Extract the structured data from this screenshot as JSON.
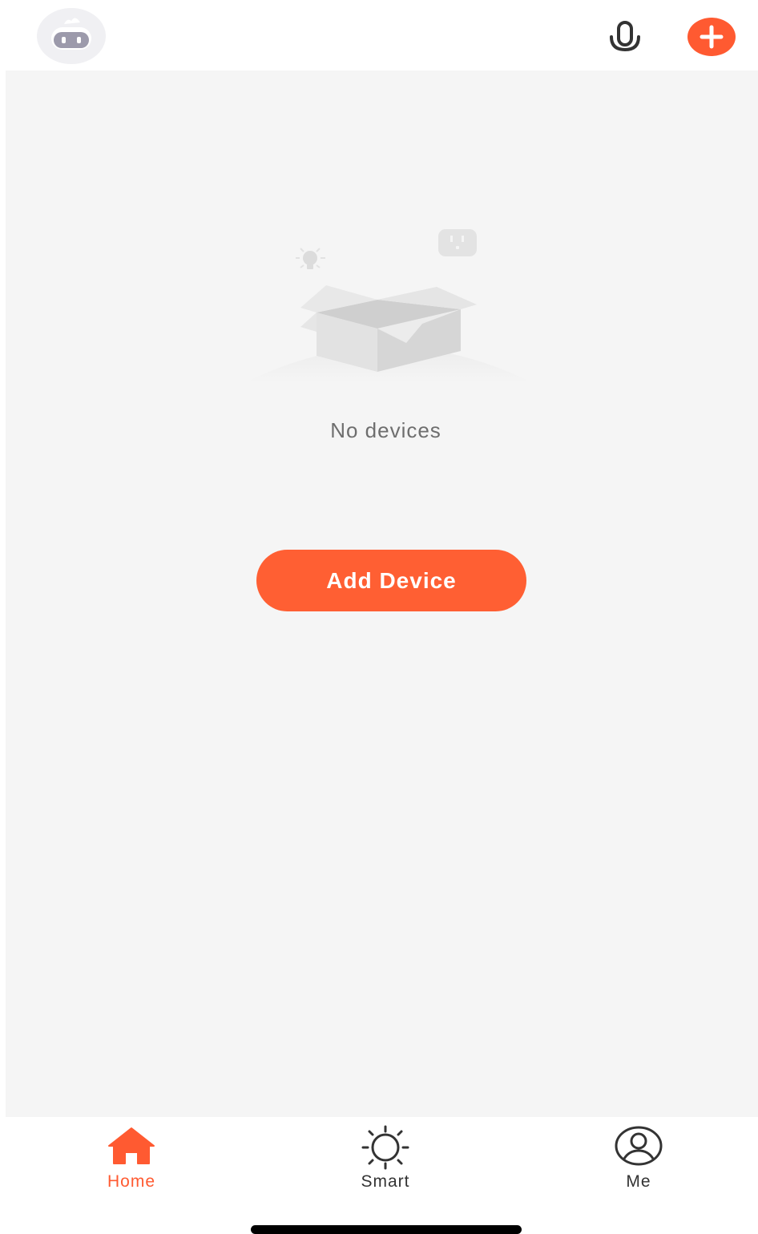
{
  "header": {
    "avatar_icon": "robot-avatar-icon",
    "mic_icon": "microphone-icon",
    "add_icon": "plus-icon"
  },
  "main": {
    "empty_illustration": "empty-box-illustration",
    "empty_text": "No devices",
    "add_device_label": "Add Device"
  },
  "tabbar": {
    "tabs": [
      {
        "label": "Home",
        "icon": "home-icon",
        "active": true
      },
      {
        "label": "Smart",
        "icon": "sun-icon",
        "active": false
      },
      {
        "label": "Me",
        "icon": "user-icon",
        "active": false
      }
    ]
  },
  "colors": {
    "accent": "#ff5a31",
    "background": "#f5f5f5",
    "text_secondary": "#6e6e6e"
  }
}
